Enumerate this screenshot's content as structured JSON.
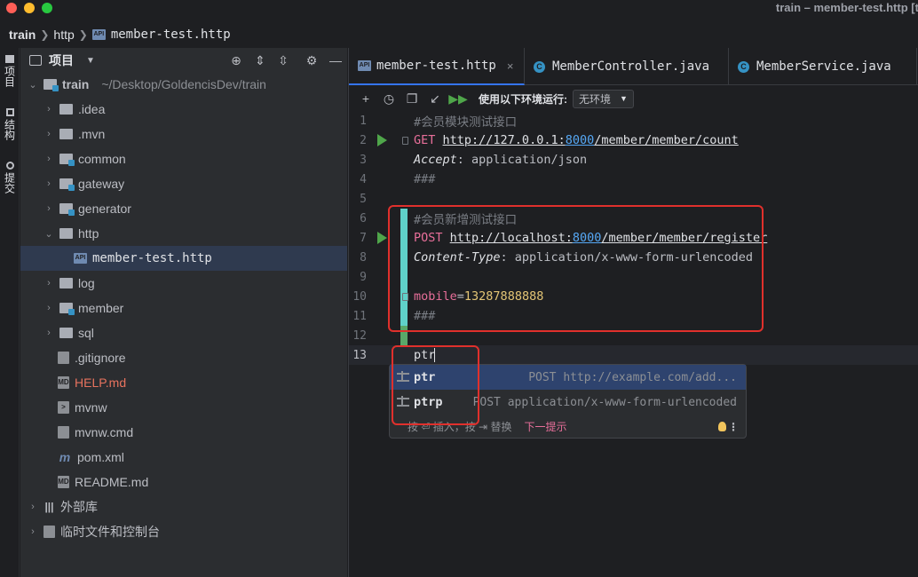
{
  "window": {
    "title": "train – member-test.http [tr",
    "traffic_lights": {
      "close": "#ff5f57",
      "minimize": "#febc2e",
      "maximize": "#28c840"
    }
  },
  "breadcrumb": {
    "items": [
      "train",
      "http",
      "member-test.http"
    ]
  },
  "tool_strip": {
    "items": [
      {
        "label": "项目",
        "icon": "folder-icon"
      },
      {
        "label": "结构",
        "icon": "structure-icon"
      },
      {
        "label": "提交",
        "icon": "commit-icon"
      }
    ]
  },
  "project": {
    "title": "项目",
    "header_icons": [
      "target-icon",
      "expand-all-icon",
      "collapse-all-icon",
      "gear-icon",
      "minimize-icon"
    ],
    "root": {
      "name": "train",
      "path": "~/Desktop/GoldencisDev/train"
    },
    "tree": [
      {
        "label": ".idea",
        "type": "folder",
        "expanded": false
      },
      {
        "label": ".mvn",
        "type": "folder",
        "expanded": false
      },
      {
        "label": "common",
        "type": "module",
        "expanded": false
      },
      {
        "label": "gateway",
        "type": "module",
        "expanded": false
      },
      {
        "label": "generator",
        "type": "module",
        "expanded": false
      },
      {
        "label": "http",
        "type": "folder",
        "expanded": true
      },
      {
        "label": "member-test.http",
        "type": "api-file",
        "selected": true
      },
      {
        "label": "log",
        "type": "folder",
        "expanded": false
      },
      {
        "label": "member",
        "type": "module",
        "expanded": false
      },
      {
        "label": "sql",
        "type": "folder",
        "expanded": false
      },
      {
        "label": ".gitignore",
        "type": "gitignore-file"
      },
      {
        "label": "HELP.md",
        "type": "md-file",
        "color": "#e8735e"
      },
      {
        "label": "mvnw",
        "type": "script-file"
      },
      {
        "label": "mvnw.cmd",
        "type": "doc-file"
      },
      {
        "label": "pom.xml",
        "type": "maven-file"
      },
      {
        "label": "README.md",
        "type": "md-file"
      }
    ],
    "external_libs": "外部库",
    "scratches": "临时文件和控制台"
  },
  "tabs": [
    {
      "label": "member-test.http",
      "icon": "api-icon",
      "active": true,
      "close": "×"
    },
    {
      "label": "MemberController.java",
      "icon": "class-icon",
      "active": false
    },
    {
      "label": "MemberService.java",
      "icon": "class-icon",
      "active": false
    }
  ],
  "http_toolbar": {
    "icons": [
      "add-icon",
      "history-icon",
      "copy-icon",
      "import-icon",
      "run-all-icon"
    ],
    "env_label": "使用以下环境运行:",
    "env_value": "无环境"
  },
  "code_lines": [
    {
      "n": "1",
      "comment": "#会员模块测试接口"
    },
    {
      "n": "2",
      "method": "GET",
      "url_a": "http://127.0.0.1:",
      "port": "8000",
      "url_b": "/member/member/count",
      "run": true
    },
    {
      "n": "3",
      "header": "Accept",
      "header_val": ": application/json"
    },
    {
      "n": "4",
      "comment": "###"
    },
    {
      "n": "5"
    },
    {
      "n": "6",
      "comment": "#会员新增测试接口"
    },
    {
      "n": "7",
      "method": "POST",
      "url_a": "http://localhost:",
      "port": "8000",
      "url_b": "/member/member/register",
      "run": true
    },
    {
      "n": "8",
      "header": "Content-Type",
      "header_val": ": application/x-www-form-urlencoded"
    },
    {
      "n": "9"
    },
    {
      "n": "10",
      "param": "mobile",
      "param_eq": "=",
      "param_val": "13287888888"
    },
    {
      "n": "11",
      "comment": "###"
    },
    {
      "n": "12"
    },
    {
      "n": "13",
      "typed": "ptr",
      "current": true
    }
  ],
  "completion": {
    "items": [
      {
        "name": "ptr",
        "desc": "POST http://example.com/add...",
        "selected": true
      },
      {
        "name": "ptrp",
        "desc": "POST application/x-www-form-urlencoded",
        "selected": false
      }
    ],
    "footer_text": "按 ⏎ 插入，按 ⇥ 替换",
    "footer_next": "下一提示"
  }
}
